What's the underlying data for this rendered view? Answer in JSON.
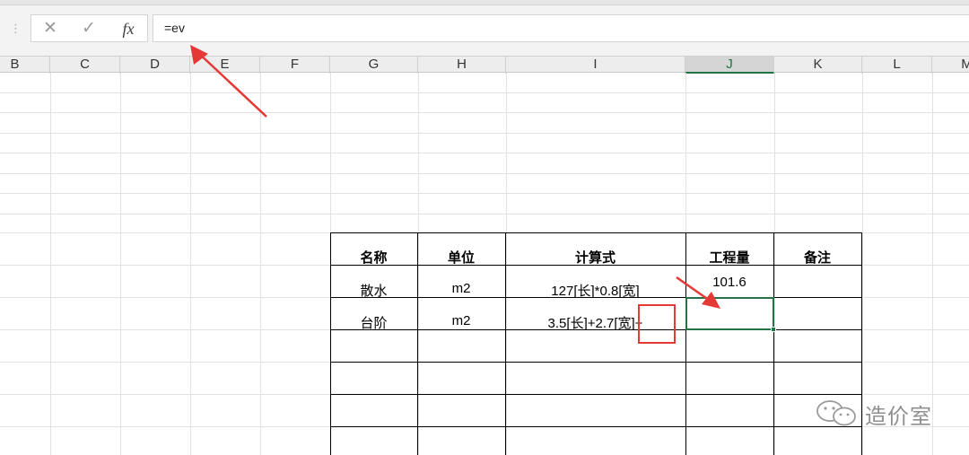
{
  "formula_bar": {
    "cancel_glyph": "✕",
    "enter_glyph": "✓",
    "fx_label": "fx",
    "formula_text": "=ev"
  },
  "columns": [
    "B",
    "C",
    "D",
    "E",
    "F",
    "G",
    "H",
    "I",
    "J",
    "K",
    "L",
    "M"
  ],
  "active_column": "J",
  "table": {
    "headers": [
      "名称",
      "单位",
      "计算式",
      "工程量",
      "备注"
    ],
    "rows": [
      {
        "name": "散水",
        "unit": "m2",
        "formula": "127[长]*0.8[宽]",
        "quantity": "101.6",
        "note": ""
      },
      {
        "name": "台阶",
        "unit": "m2",
        "formula": "3.5[长]+2.7[宽]+",
        "quantity": "",
        "note": ""
      }
    ]
  },
  "watermark": {
    "icon": "wechat-icon",
    "text": "造价室"
  },
  "colors": {
    "accent_green": "#217346",
    "annotation_red": "#e53935"
  }
}
